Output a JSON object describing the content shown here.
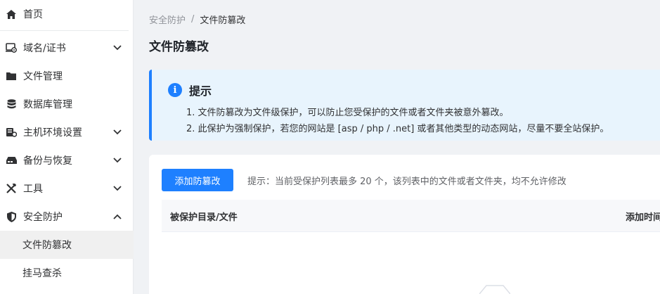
{
  "sidebar": {
    "items": [
      {
        "label": "首页",
        "icon": "home-icon",
        "expandable": false
      },
      {
        "label": "域名/证书",
        "icon": "domain-certificate-icon",
        "expandable": true,
        "expanded": false
      },
      {
        "label": "文件管理",
        "icon": "folder-icon",
        "expandable": false
      },
      {
        "label": "数据库管理",
        "icon": "database-icon",
        "expandable": false
      },
      {
        "label": "主机环境设置",
        "icon": "server-settings-icon",
        "expandable": true,
        "expanded": false
      },
      {
        "label": "备份与恢复",
        "icon": "backup-drive-icon",
        "expandable": true,
        "expanded": false
      },
      {
        "label": "工具",
        "icon": "tools-icon",
        "expandable": true,
        "expanded": false
      },
      {
        "label": "安全防护",
        "icon": "shield-icon",
        "expandable": true,
        "expanded": true
      }
    ],
    "sub_items": [
      {
        "label": "文件防篡改",
        "active": true
      },
      {
        "label": "挂马查杀",
        "active": false
      }
    ]
  },
  "breadcrumb": {
    "parent": "安全防护",
    "separator": "/",
    "current": "文件防篡改"
  },
  "page": {
    "title": "文件防篡改"
  },
  "tip": {
    "title": "提示",
    "lines": [
      "1. 文件防篡改为文件级保护，可以防止您受保护的文件或者文件夹被意外篡改。",
      "2. 此保护为强制保护，若您的网站是 [asp / php / .net] 或者其他类型的动态网站，尽量不要全站保护。"
    ]
  },
  "toolbar": {
    "add_button": "添加防篡改",
    "hint": "提示：当前受保护列表最多 20 个，该列表中的文件或者文件夹，均不允许修改"
  },
  "table": {
    "columns": [
      "被保护目录/文件",
      "添加时间"
    ]
  },
  "colors": {
    "accent": "#1e80ff",
    "tip_background": "#e8f4fd",
    "page_background": "#f0f2f5"
  }
}
